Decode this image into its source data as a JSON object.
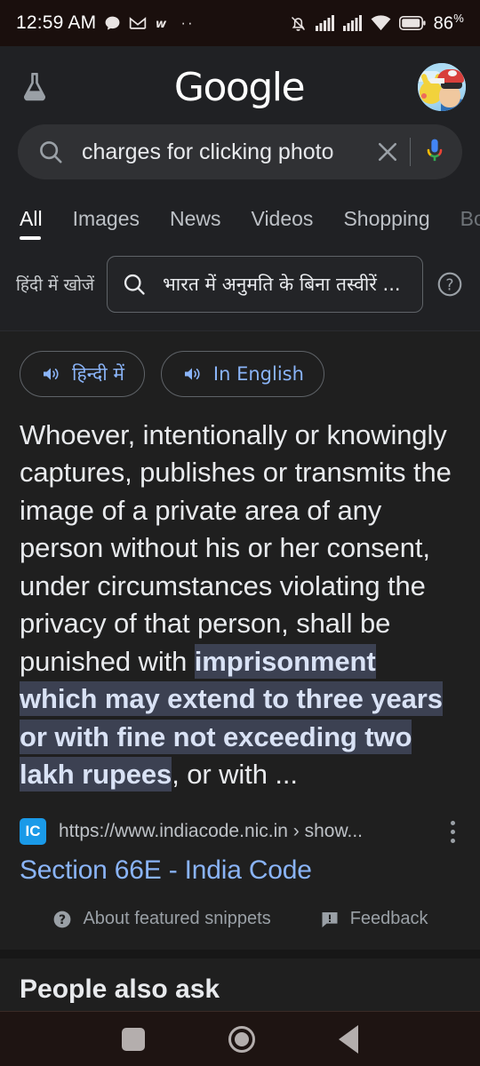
{
  "status_bar": {
    "time": "12:59 AM",
    "left_icons": [
      "chat-bubble-icon",
      "gmail-icon",
      "w-app-icon",
      "more-dots-icon"
    ],
    "right_icons": [
      "notifications-muted-icon",
      "signal-sim1-icon",
      "signal-sim2-icon",
      "wifi-icon",
      "battery-icon"
    ],
    "battery_level": "86",
    "battery_unit": "%"
  },
  "header": {
    "labs_icon": "flask-icon",
    "logo_text": "Google",
    "avatar_name": "account-avatar"
  },
  "search": {
    "query": "charges for clicking photo",
    "search_icon": "search-icon",
    "clear_icon": "close-icon",
    "mic_icon": "microphone-icon"
  },
  "tabs": [
    {
      "label": "All",
      "active": true
    },
    {
      "label": "Images",
      "active": false
    },
    {
      "label": "News",
      "active": false
    },
    {
      "label": "Videos",
      "active": false
    },
    {
      "label": "Shopping",
      "active": false
    },
    {
      "label": "Bo",
      "active": false
    }
  ],
  "hindi_row": {
    "label": "हिंदी में खोजें",
    "query": "भारत में अनुमति के बिना तस्वीरें ...",
    "search_icon": "search-icon",
    "help_icon": "help-circle-icon"
  },
  "snippet": {
    "pills": [
      {
        "label": "हिन्दी में",
        "icon": "speaker-icon"
      },
      {
        "label": "In English",
        "icon": "speaker-icon"
      }
    ],
    "text_before": "Whoever, intentionally or knowingly captures, publishes or transmits the image of a private area of any person without his or her consent, under circumstances violating the privacy of that person, shall be punished with ",
    "text_highlight": "imprisonment which may extend to three years or with fine not exceeding two lakh rupees",
    "text_after": ", or with ...",
    "highlight_bg": "#3c4152",
    "highlight_color": "#d9e2f5"
  },
  "source": {
    "favicon_text": "IC",
    "favicon_color": "#1a9ae8",
    "url": "https://www.indiacode.nic.in › show...",
    "title": "Section 66E - India Code",
    "title_color": "#8ab4f8",
    "menu_icon": "kebab-menu-icon"
  },
  "card_footer": {
    "about_label": "About featured snippets",
    "about_icon": "help-circle-icon",
    "feedback_label": "Feedback",
    "feedback_icon": "feedback-icon"
  },
  "next_section": {
    "title": "People also ask"
  },
  "nav_bar": {
    "recents": "recents-square-icon",
    "home": "home-circle-icon",
    "back": "back-triangle-icon"
  }
}
